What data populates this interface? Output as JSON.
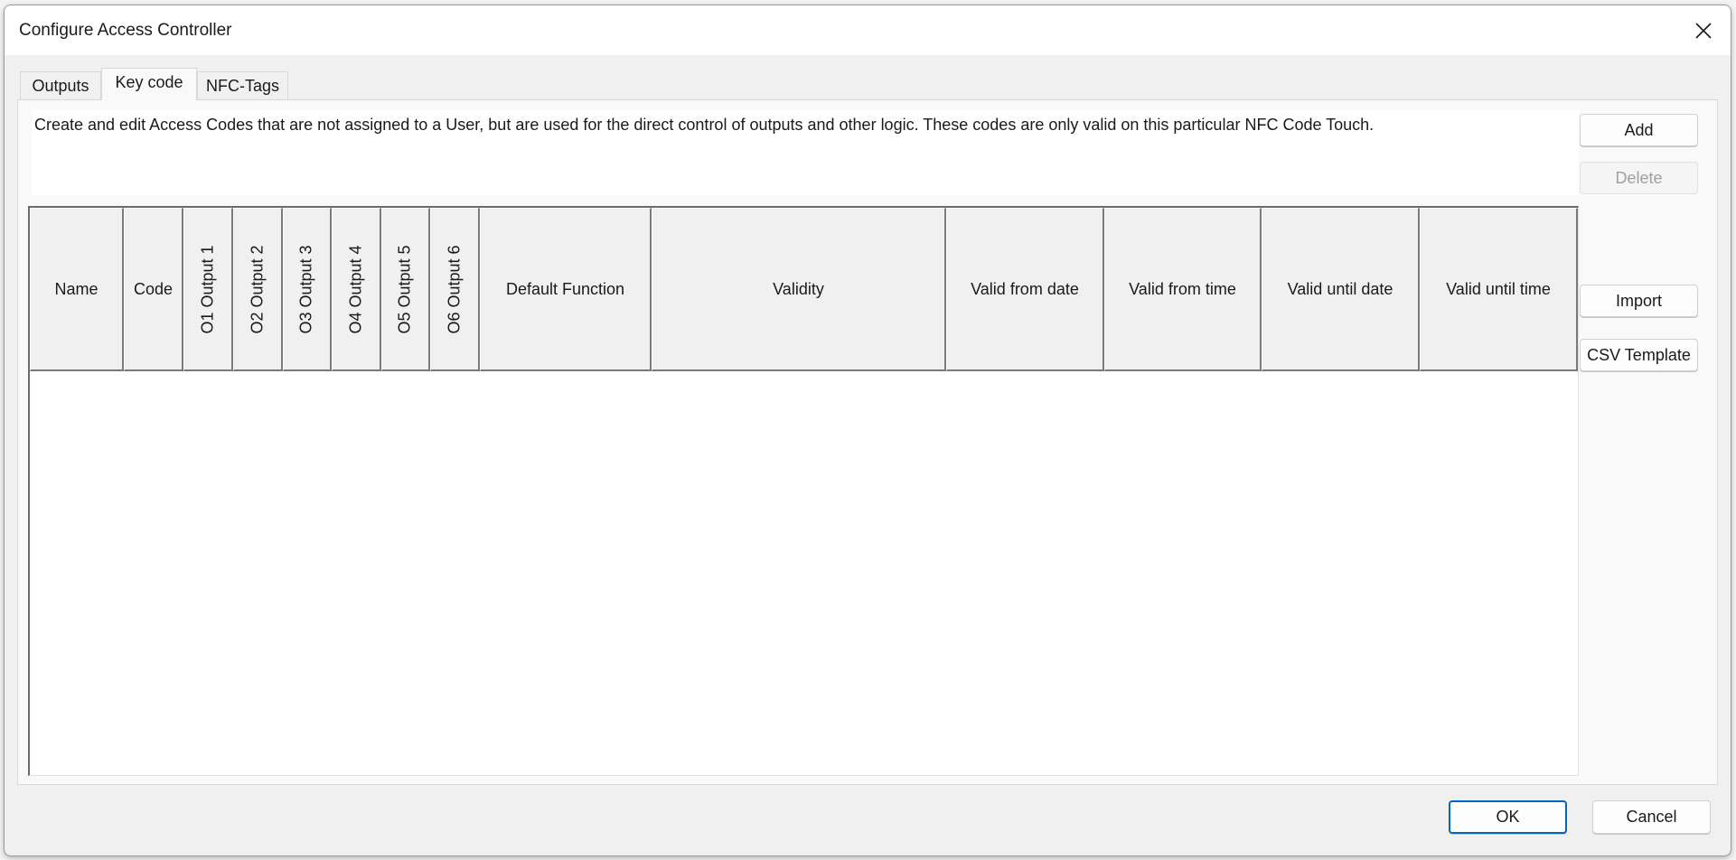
{
  "window": {
    "title": "Configure Access Controller",
    "close_icon": "close-icon"
  },
  "tabs": [
    {
      "label": "Outputs",
      "selected": false
    },
    {
      "label": "Key code",
      "selected": true
    },
    {
      "label": "NFC-Tags",
      "selected": false
    }
  ],
  "description": "Create and edit Access Codes that are not assigned to a User, but are used for the direct control of outputs and other logic. These codes are only valid on this particular NFC Code Touch.",
  "table": {
    "columns": [
      {
        "label": "Name",
        "vertical": false
      },
      {
        "label": "Code",
        "vertical": false
      },
      {
        "label": "O1 Output 1",
        "vertical": true
      },
      {
        "label": "O2 Output 2",
        "vertical": true
      },
      {
        "label": "O3 Output 3",
        "vertical": true
      },
      {
        "label": "O4 Output 4",
        "vertical": true
      },
      {
        "label": "O5 Output 5",
        "vertical": true
      },
      {
        "label": "O6 Output 6",
        "vertical": true
      },
      {
        "label": "Default Function",
        "vertical": false
      },
      {
        "label": "Validity",
        "vertical": false
      },
      {
        "label": "Valid from date",
        "vertical": false
      },
      {
        "label": "Valid from time",
        "vertical": false
      },
      {
        "label": "Valid until date",
        "vertical": false
      },
      {
        "label": "Valid until time",
        "vertical": false
      }
    ],
    "rows": []
  },
  "side_buttons": {
    "add": "Add",
    "delete": "Delete",
    "delete_enabled": false,
    "import": "Import",
    "csv_template": "CSV Template"
  },
  "footer": {
    "ok": "OK",
    "cancel": "Cancel"
  },
  "colors": {
    "accent": "#0067c0",
    "dialog_bg": "#f0f0f0",
    "disabled_text": "#a0a0a0"
  }
}
